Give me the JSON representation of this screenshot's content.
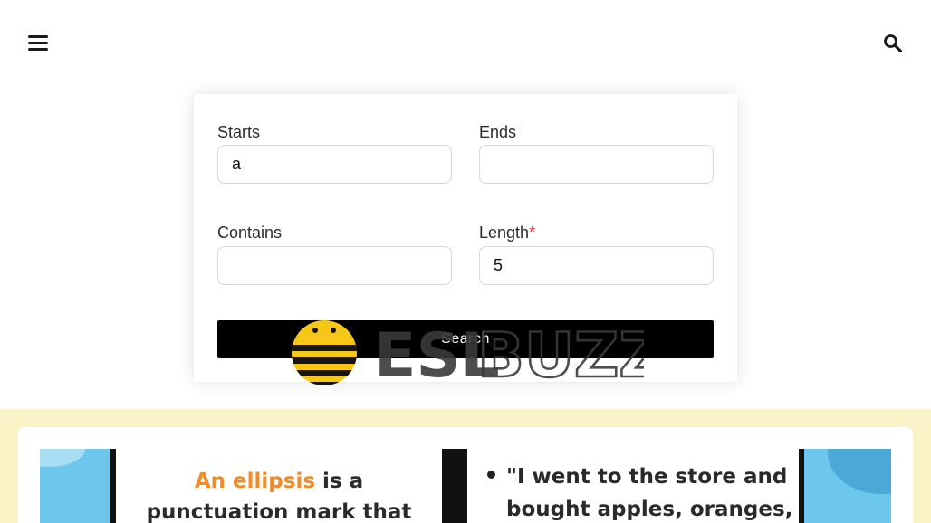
{
  "header": {
    "menu_icon": "hamburger-menu-icon",
    "search_icon": "search-icon"
  },
  "form": {
    "starts_label": "Starts",
    "starts_value": "a",
    "ends_label": "Ends",
    "ends_value": "",
    "contains_label": "Contains",
    "contains_value": "",
    "length_label": "Length",
    "length_required_mark": "*",
    "length_value": "5",
    "search_label": "Search"
  },
  "logo": {
    "part1": "ESL",
    "part2": "BUZZ"
  },
  "infographic": {
    "left_highlight": "An ellipsis",
    "left_text_1": " is a",
    "left_text_2": "punctuation mark that",
    "right_line_1": "\"I went to the store and",
    "right_line_2": "bought apples, oranges,"
  },
  "colors": {
    "accent_yellow": "#fbf3c8",
    "required_red": "#e53935",
    "infographic_blue": "#6dc7ec",
    "highlight_orange": "#f28c28"
  }
}
